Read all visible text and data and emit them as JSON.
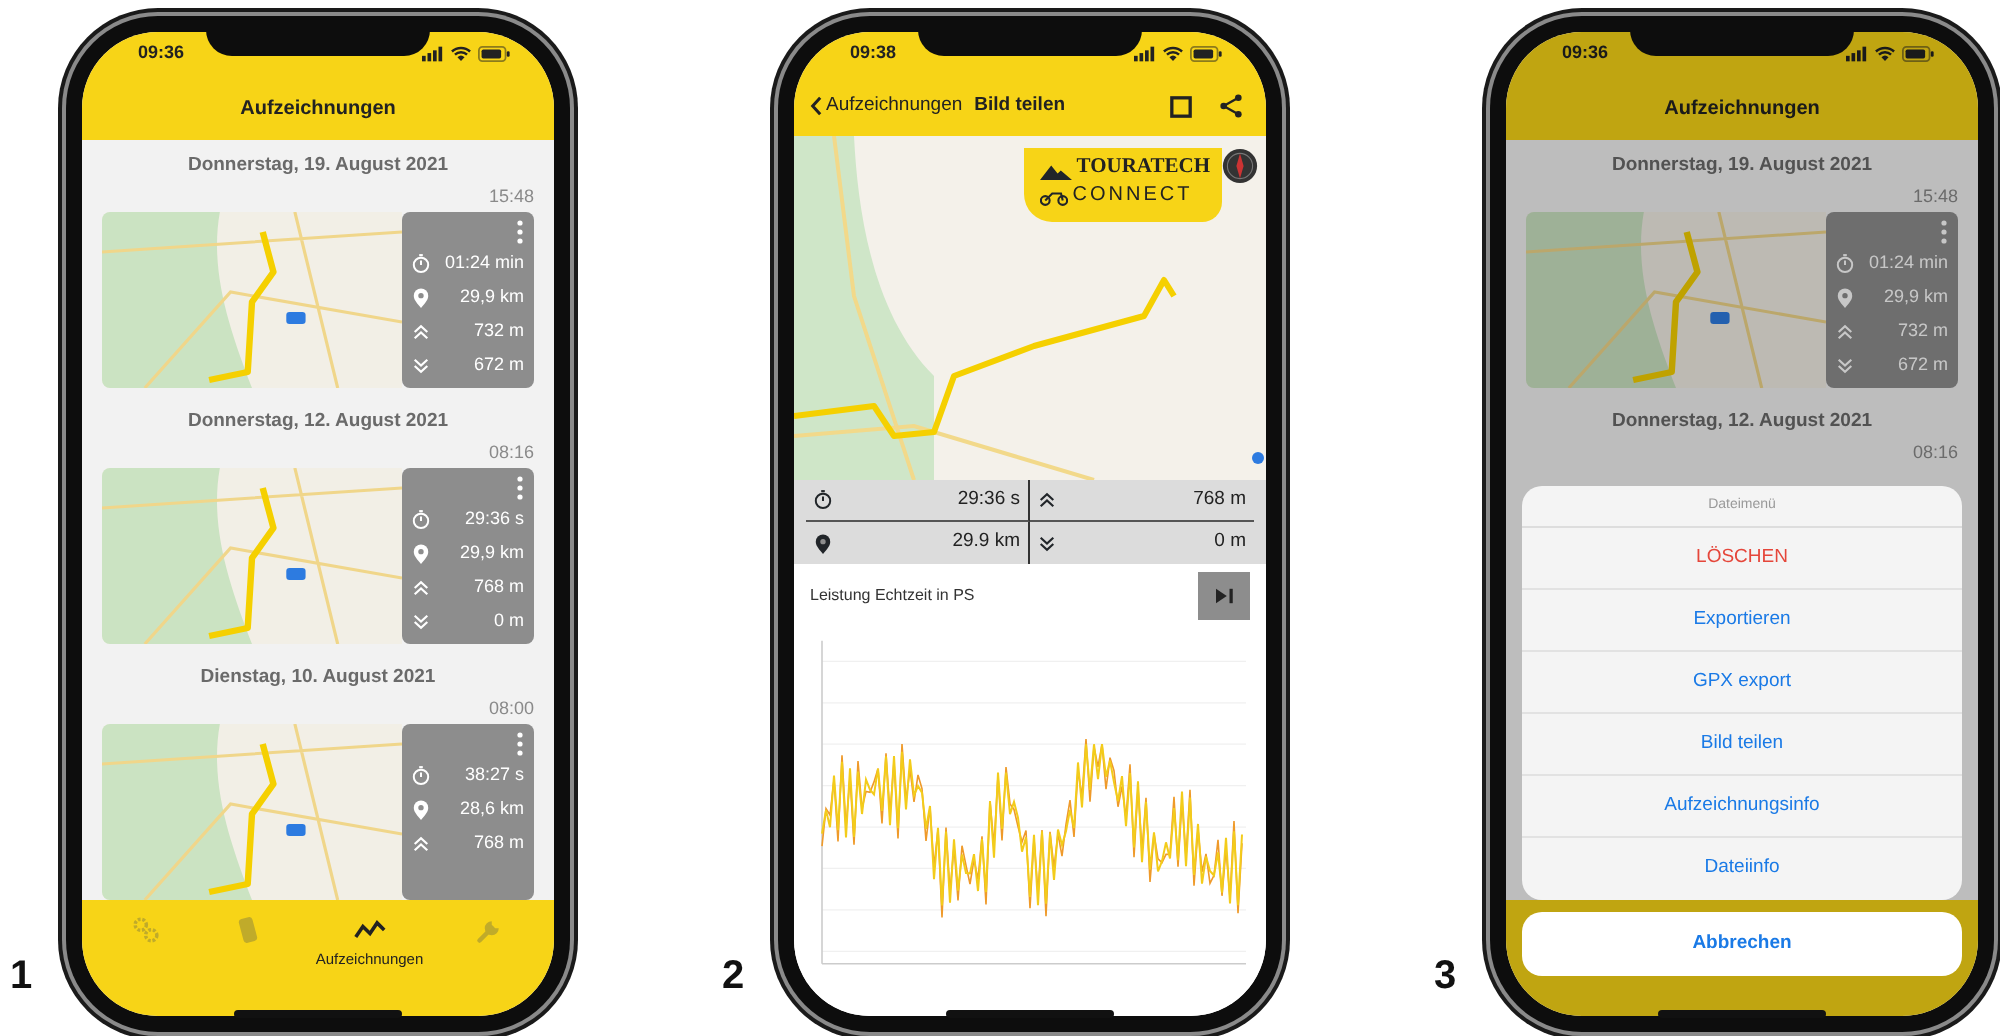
{
  "panels": [
    {
      "number": "1",
      "kind": "list",
      "status_time": "09:36",
      "title": "Aufzeichnungen",
      "recordings": [
        {
          "date": "Donnerstag, 19. August 2021",
          "time": "15:48",
          "stats": [
            {
              "kind": "duration",
              "value": "01:24 min"
            },
            {
              "kind": "distance",
              "value": "29,9 km"
            },
            {
              "kind": "ascent",
              "value": "732 m"
            },
            {
              "kind": "descent",
              "value": "672 m"
            }
          ]
        },
        {
          "date": "Donnerstag, 12. August 2021",
          "time": "08:16",
          "stats": [
            {
              "kind": "duration",
              "value": "29:36 s"
            },
            {
              "kind": "distance",
              "value": "29,9 km"
            },
            {
              "kind": "ascent",
              "value": "768 m"
            },
            {
              "kind": "descent",
              "value": "0 m"
            }
          ]
        },
        {
          "date": "Dienstag, 10. August 2021",
          "time": "08:00",
          "stats": [
            {
              "kind": "duration",
              "value": "38:27 s"
            },
            {
              "kind": "distance",
              "value": "28,6 km"
            },
            {
              "kind": "ascent",
              "value": "768 m"
            }
          ]
        }
      ],
      "tabs": [
        {
          "kind": "gears",
          "selected": false
        },
        {
          "kind": "device",
          "selected": false
        },
        {
          "kind": "graph",
          "label": "Aufzeichnungen",
          "selected": true
        },
        {
          "kind": "wrench",
          "selected": false
        }
      ]
    },
    {
      "number": "2",
      "kind": "share",
      "status_time": "09:38",
      "back_label": "Aufzeichnungen",
      "title": "Bild teilen",
      "logo": {
        "brand": "TOURATECH",
        "product": "CONNECT"
      },
      "stats": [
        {
          "kind": "duration",
          "value": "29:36 s"
        },
        {
          "kind": "ascent",
          "value": "768 m"
        },
        {
          "kind": "distance",
          "value": "29.9 km"
        },
        {
          "kind": "descent",
          "value": "0 m"
        }
      ],
      "chart_title": "Leistung Echtzeit in PS"
    },
    {
      "number": "3",
      "kind": "list",
      "status_time": "09:36",
      "title": "Aufzeichnungen",
      "recordings": [
        {
          "date": "Donnerstag, 19. August 2021",
          "time": "15:48",
          "stats": [
            {
              "kind": "duration",
              "value": "01:24 min"
            },
            {
              "kind": "distance",
              "value": "29,9 km"
            },
            {
              "kind": "ascent",
              "value": "732 m"
            },
            {
              "kind": "descent",
              "value": "672 m"
            }
          ]
        },
        {
          "date": "Donnerstag, 12. August 2021",
          "time": "08:16"
        }
      ],
      "action_sheet": {
        "title": "Dateimenü",
        "items": [
          {
            "label": "LÖSCHEN",
            "kind": "destructive"
          },
          {
            "label": "Exportieren",
            "kind": "default"
          },
          {
            "label": "GPX export",
            "kind": "default"
          },
          {
            "label": "Bild teilen",
            "kind": "default"
          },
          {
            "label": "Aufzeichnungsinfo",
            "kind": "default"
          },
          {
            "label": "Dateiinfo",
            "kind": "default"
          }
        ],
        "cancel": "Abbrechen"
      }
    }
  ]
}
